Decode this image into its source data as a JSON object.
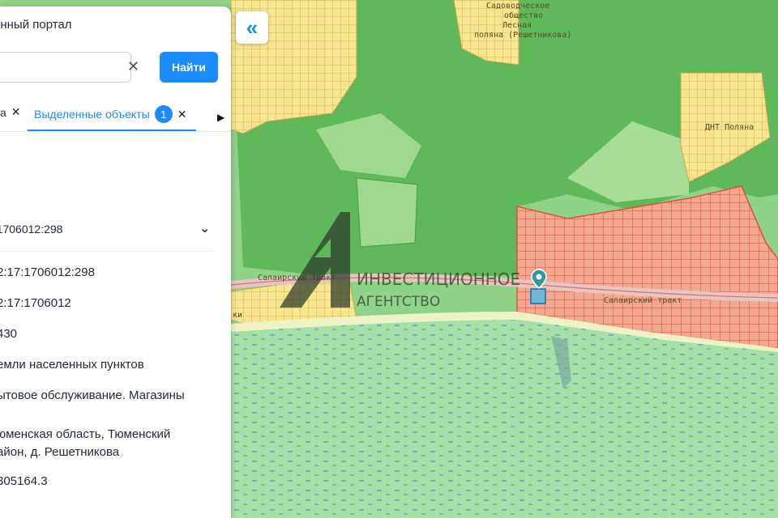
{
  "panel": {
    "title": "онный портал",
    "find_label": "Найти",
    "tab_prev": "а",
    "tab_active": "Выделенные объекты",
    "tab_badge": "1",
    "accordion_label": "7:1706012:298",
    "values": [
      "2:17:1706012:298",
      "2:17:1706012",
      "430",
      "емли населенных пунктов",
      "ытовое обслуживание. Магазины",
      "юменская область, Тюменский",
      "айон, д. Решетникова",
      "305164.3"
    ]
  },
  "map": {
    "labels": {
      "garden_1": "Садоводческое",
      "garden_2": "общество",
      "garden_3": "Лесная",
      "garden_4": "поляна (Решетникова)",
      "tract_left": "Салаирский тракт",
      "tract_right": "Салаирский тракт",
      "village_left": "ки",
      "dnt": "ДНТ Поляна"
    },
    "watermark_line1": "ИНВЕСТИЦИОННОЕ",
    "watermark_line2": "АГЕНТСТВО",
    "colors": {
      "forest": "#5fb85a",
      "meadow": "#8fd28a",
      "settlement": "#f7e68f",
      "zone_red": "#f2a891",
      "water": "#a6e0a4",
      "accent": "#1a8cff"
    }
  },
  "icons": [
    "collapse-icon",
    "clear-icon",
    "close-icon",
    "chevron-down-icon",
    "chevron-right-icon",
    "map-pin-icon"
  ]
}
